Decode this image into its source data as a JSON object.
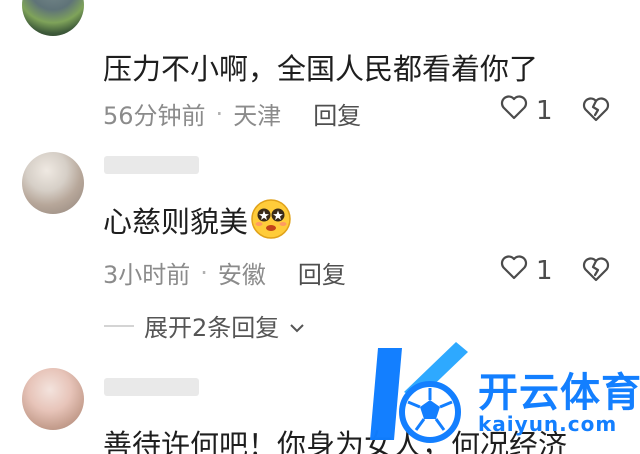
{
  "comments": [
    {
      "text": "压力不小啊，全国人民都看着你了",
      "time": "56分钟前",
      "location": "天津",
      "reply_label": "回复",
      "likes": "1"
    },
    {
      "text": "心慈则貌美",
      "time": "3小时前",
      "location": "安徽",
      "reply_label": "回复",
      "likes": "1"
    },
    {
      "text": "善待许何吧！你身为女人，何况经济"
    }
  ],
  "expand_replies": "展开2条回复",
  "separator": "·",
  "watermark": {
    "title": "开云体育",
    "subtitle": "kaiyun.com"
  }
}
